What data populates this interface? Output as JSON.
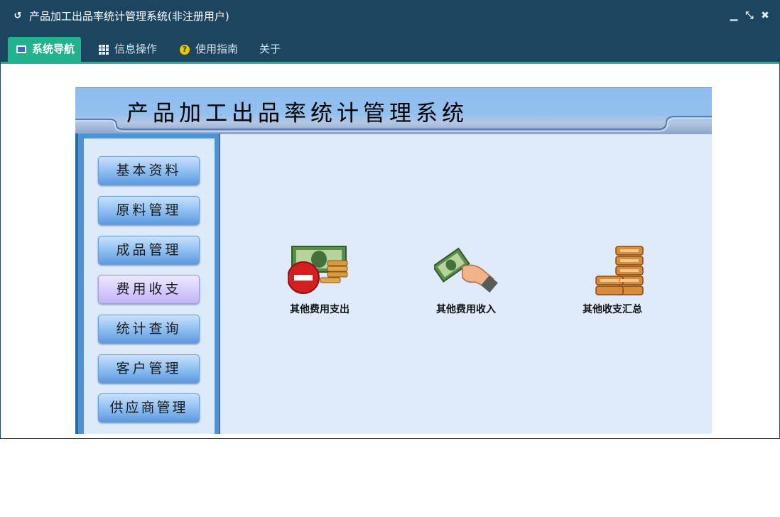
{
  "window": {
    "title": "产品加工出品率统计管理系统(非注册用户)",
    "controls": [
      "minimize-icon",
      "restore-icon",
      "close-icon"
    ]
  },
  "menu": {
    "tabs": [
      {
        "label": "系统导航",
        "icon": "monitor-icon",
        "active": true
      },
      {
        "label": "信息操作",
        "icon": "grid-icon",
        "active": false
      },
      {
        "label": "使用指南",
        "icon": "help-icon",
        "active": false
      },
      {
        "label": "关于",
        "icon": "",
        "active": false
      }
    ],
    "accent_color": "#21b38e",
    "bar_color": "#1c4560"
  },
  "banner": {
    "title": "产品加工出品率统计管理系统"
  },
  "sidebar": {
    "items": [
      {
        "label": "基本资料",
        "selected": false
      },
      {
        "label": "原料管理",
        "selected": false
      },
      {
        "label": "成品管理",
        "selected": false
      },
      {
        "label": "费用收支",
        "selected": true
      },
      {
        "label": "统计查询",
        "selected": false
      },
      {
        "label": "客户管理",
        "selected": false
      },
      {
        "label": "供应商管理",
        "selected": false
      }
    ]
  },
  "functions": [
    {
      "label": "其他费用支出",
      "icon": "expense-money-icon"
    },
    {
      "label": "其他费用收入",
      "icon": "income-hand-money-icon"
    },
    {
      "label": "其他收支汇总",
      "icon": "coin-stack-icon"
    }
  ]
}
